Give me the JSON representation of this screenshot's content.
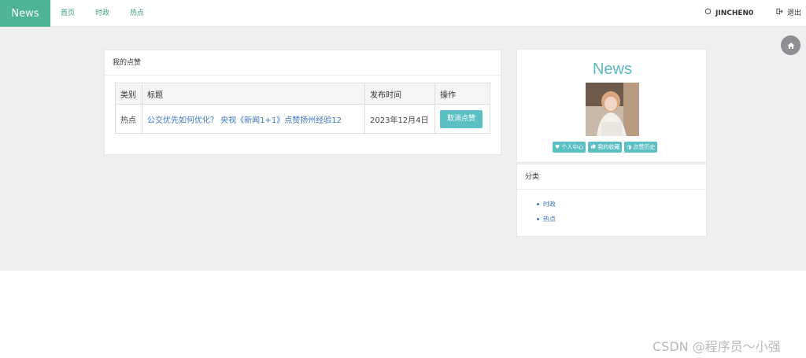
{
  "nav": {
    "brand": "News",
    "links": [
      "首页",
      "时政",
      "热点"
    ],
    "user": "JINCHEN0",
    "logout": "退出"
  },
  "likes": {
    "panel_title": "我的点赞",
    "columns": [
      "类别",
      "标题",
      "发布时间",
      "操作"
    ],
    "rows": [
      {
        "category": "热点",
        "title": "公交优先如何优化？ 央视《新闻1+1》点赞扬州经验12",
        "date": "2023年12月4日",
        "action": "取消点赞"
      }
    ]
  },
  "profile": {
    "title": "News",
    "links": [
      "个人中心",
      "我的收藏",
      "点赞历史"
    ]
  },
  "categories": {
    "panel_title": "分类",
    "items": [
      "时政",
      "热点"
    ]
  },
  "watermark": "CSDN @程序员～小强",
  "colors": {
    "brand_green": "#4fb496",
    "accent_teal": "#5bc0c4",
    "link_blue": "#3a76b8"
  }
}
